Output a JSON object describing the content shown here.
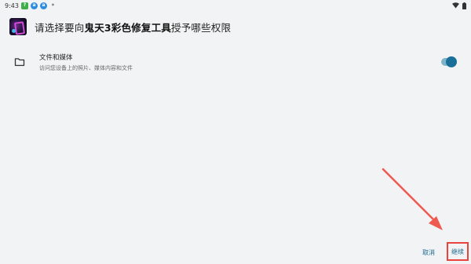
{
  "status_bar": {
    "time": "9:43",
    "notification_icons": [
      {
        "name": "app-green-icon",
        "color": "#3fae49",
        "glyph": "?"
      },
      {
        "name": "app-blue-icon-1",
        "color": "#2f8de0",
        "glyph": "a"
      },
      {
        "name": "app-blue-icon-2",
        "color": "#2f8de0",
        "glyph": "a"
      },
      {
        "name": "app-gray-icon",
        "color": "#8a8a8a",
        "glyph": "•"
      }
    ]
  },
  "dialog": {
    "title_prefix": "请选择要向",
    "app_name": "鬼天3彩色修复工具",
    "title_suffix": "授予哪些权限"
  },
  "permission": {
    "title": "文件和媒体",
    "subtitle": "访问您设备上的照片、媒体内容和文件",
    "enabled": true
  },
  "buttons": {
    "cancel": "取消",
    "continue": "继续"
  },
  "colors": {
    "accent": "#1a6f98",
    "highlight": "#e8433c"
  }
}
